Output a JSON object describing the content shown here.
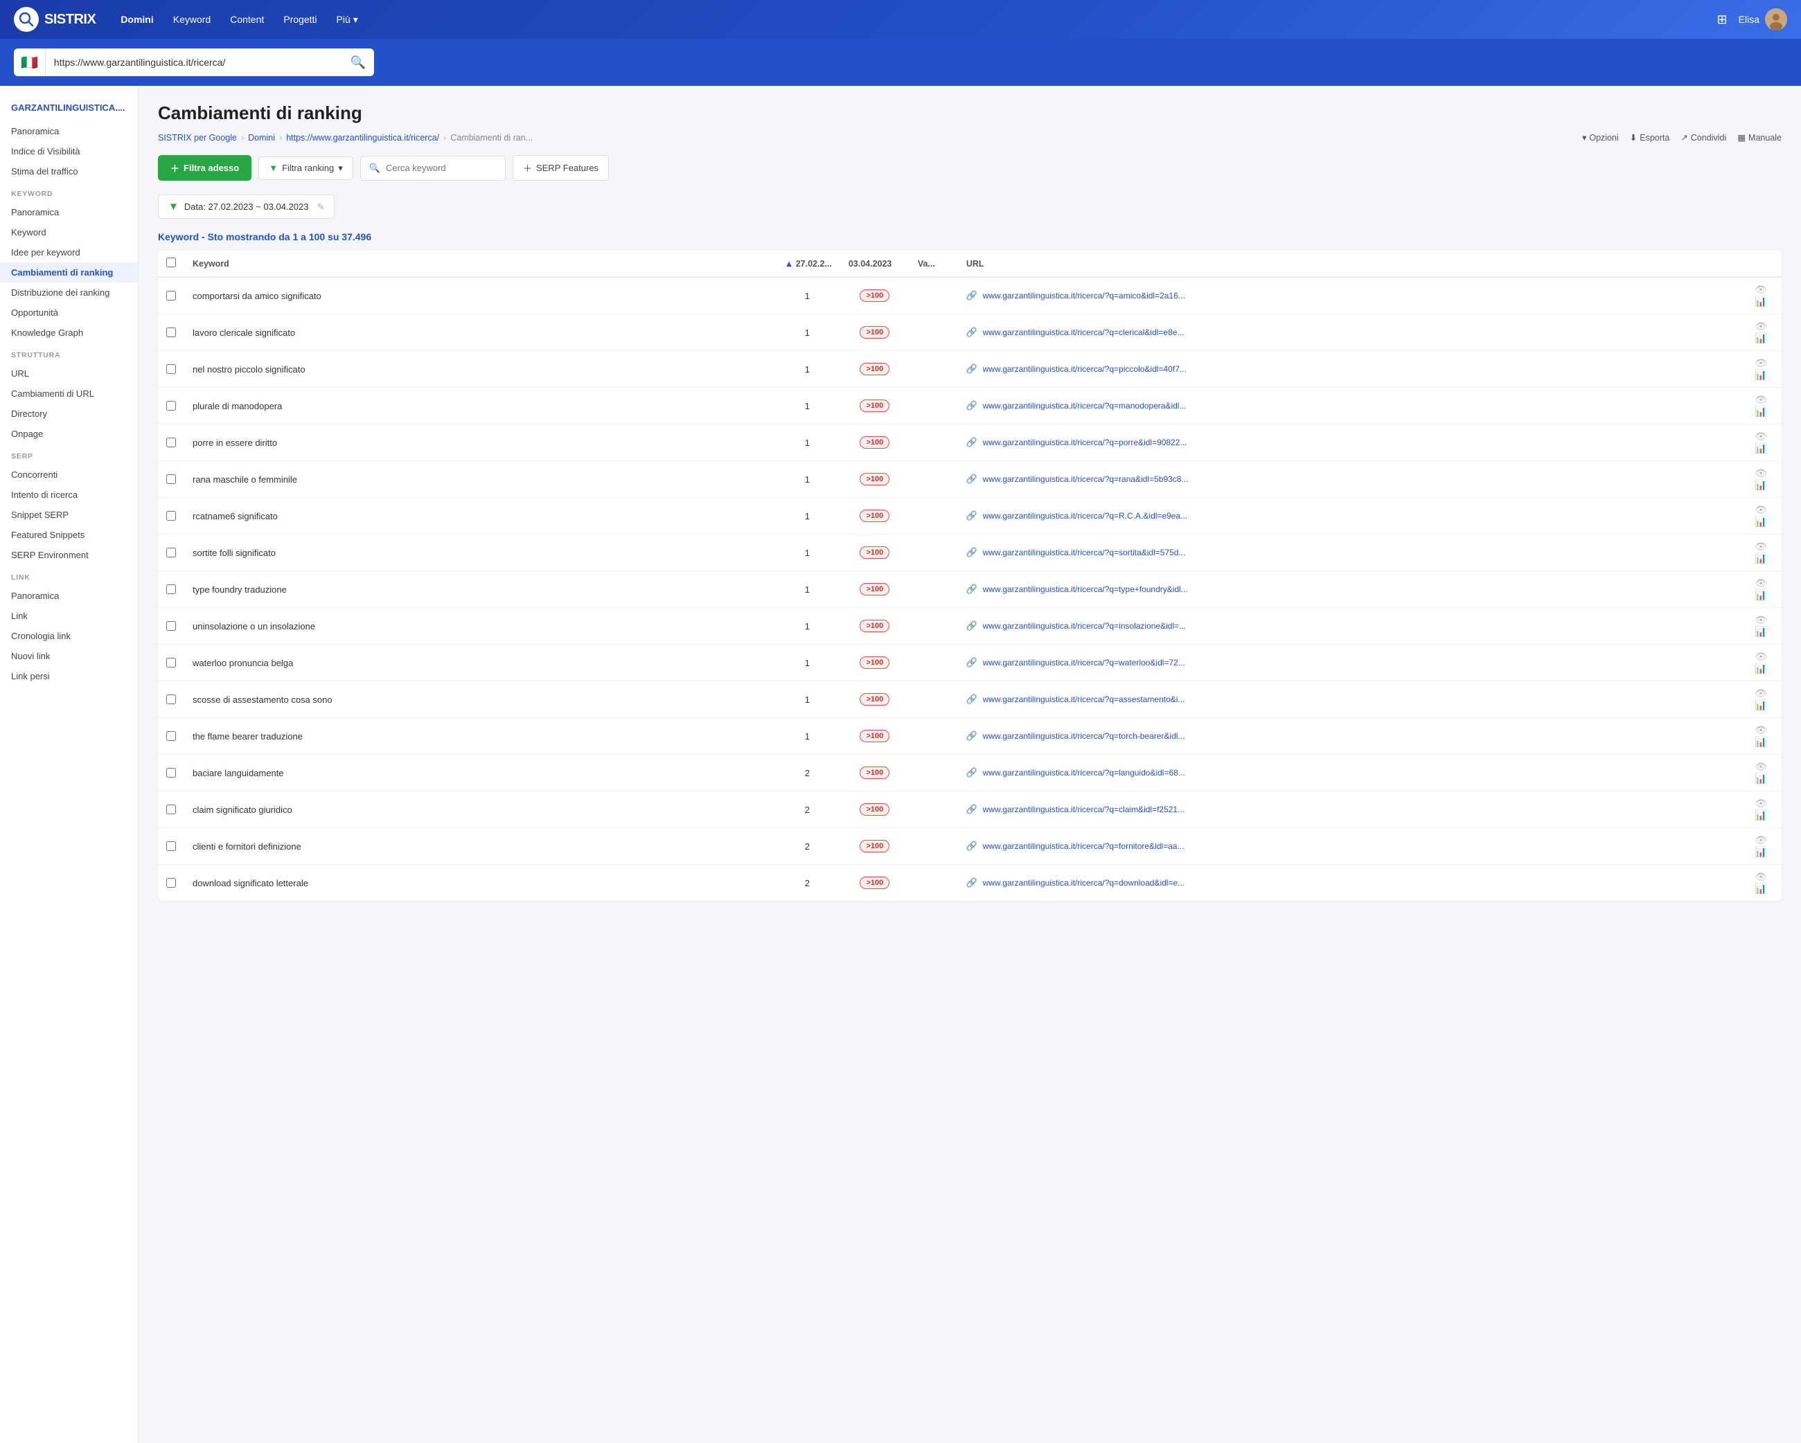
{
  "topnav": {
    "logo_text": "SISTRIX",
    "nav_items": [
      {
        "label": "Domini",
        "active": true
      },
      {
        "label": "Keyword",
        "active": false
      },
      {
        "label": "Content",
        "active": false
      },
      {
        "label": "Progetti",
        "active": false
      },
      {
        "label": "Più",
        "active": false,
        "dropdown": true
      }
    ],
    "user_name": "Elisa"
  },
  "searchbar": {
    "flag": "🇮🇹",
    "url_value": "https://www.garzantilinguistica.it/ricerca/",
    "placeholder": "https://www.garzantilinguistica.it/ricerca/"
  },
  "sidebar": {
    "domain": "GARZANTILINGUISTICA....",
    "sections": [
      {
        "items": [
          {
            "label": "Panoramica",
            "active": false
          },
          {
            "label": "Indice di Visibilità",
            "active": false
          },
          {
            "label": "Stima del traffico",
            "active": false
          }
        ]
      },
      {
        "title": "KEYWORD",
        "items": [
          {
            "label": "Panoramica",
            "active": false
          },
          {
            "label": "Keyword",
            "active": false
          },
          {
            "label": "Idee per keyword",
            "active": false
          },
          {
            "label": "Cambiamenti di ranking",
            "active": true
          },
          {
            "label": "Distribuzione dei ranking",
            "active": false
          },
          {
            "label": "Opportunità",
            "active": false
          },
          {
            "label": "Knowledge Graph",
            "active": false
          }
        ]
      },
      {
        "title": "STRUTTURA",
        "items": [
          {
            "label": "URL",
            "active": false
          },
          {
            "label": "Cambiamenti di URL",
            "active": false
          },
          {
            "label": "Directory",
            "active": false
          },
          {
            "label": "Onpage",
            "active": false
          }
        ]
      },
      {
        "title": "SERP",
        "items": [
          {
            "label": "Concorrenti",
            "active": false
          },
          {
            "label": "Intento di ricerca",
            "active": false
          },
          {
            "label": "Snippet SERP",
            "active": false
          },
          {
            "label": "Featured Snippets",
            "active": false
          },
          {
            "label": "SERP Environment",
            "active": false
          }
        ]
      },
      {
        "title": "LINK",
        "items": [
          {
            "label": "Panoramica",
            "active": false
          },
          {
            "label": "Link",
            "active": false
          },
          {
            "label": "Cronologia link",
            "active": false
          },
          {
            "label": "Nuovi link",
            "active": false
          },
          {
            "label": "Link persi",
            "active": false
          }
        ]
      }
    ]
  },
  "main": {
    "page_title": "Cambiamenti di ranking",
    "breadcrumb": {
      "items": [
        {
          "label": "SISTRIX per Google",
          "link": true
        },
        {
          "label": "Domini",
          "link": true
        },
        {
          "label": "https://www.garzantilinguistica.it/ricerca/",
          "link": true
        },
        {
          "label": "Cambiamenti di ran...",
          "link": false
        }
      ],
      "actions": [
        {
          "label": "Opzioni",
          "icon": "▼"
        },
        {
          "label": "Esporta",
          "icon": "⬇"
        },
        {
          "label": "Condividi",
          "icon": "↗"
        },
        {
          "label": "Manuale",
          "icon": "▦"
        }
      ]
    },
    "toolbar": {
      "filter_now": "Filtra adesso",
      "filter_ranking": "Filtra ranking",
      "search_placeholder": "Cerca keyword",
      "serp_features": "SERP Features"
    },
    "date_filter": {
      "text": "Data: 27.02.2023 ~ 03.04.2023"
    },
    "section_heading": "Keyword - Sto mostrando da 1 a 100 su 37.496",
    "table": {
      "headers": [
        {
          "label": "",
          "type": "check"
        },
        {
          "label": "Keyword",
          "sortable": true
        },
        {
          "label": "27.02.2...",
          "sortable": true,
          "active": true
        },
        {
          "label": "03.04.2023",
          "sortable": true
        },
        {
          "label": "Va...",
          "sortable": true
        },
        {
          "label": "URL",
          "sortable": false
        }
      ],
      "rows": [
        {
          "keyword": "comportarsi da amico significato",
          "date1": "1",
          "date2": ">100",
          "url": "www.garzantilinguistica.it/ricerca/?q=amico&idl=2a16..."
        },
        {
          "keyword": "lavoro clericale significato",
          "date1": "1",
          "date2": ">100",
          "url": "www.garzantilinguistica.it/ricerca/?q=clerical&idl=e8e..."
        },
        {
          "keyword": "nel nostro piccolo significato",
          "date1": "1",
          "date2": ">100",
          "url": "www.garzantilinguistica.it/ricerca/?q=piccolo&idl=40f7..."
        },
        {
          "keyword": "plurale di manodopera",
          "date1": "1",
          "date2": ">100",
          "url": "www.garzantilinguistica.it/ricerca/?q=manodopera&idl..."
        },
        {
          "keyword": "porre in essere diritto",
          "date1": "1",
          "date2": ">100",
          "url": "www.garzantilinguistica.it/ricerca/?q=porre&idl=90822..."
        },
        {
          "keyword": "rana maschile o femminile",
          "date1": "1",
          "date2": ">100",
          "url": "www.garzantilinguistica.it/ricerca/?q=rana&idl=5b93c8..."
        },
        {
          "keyword": "rcatname6 significato",
          "date1": "1",
          "date2": ">100",
          "url": "www.garzantilinguistica.it/ricerca/?q=R.C.A.&idl=e9ea..."
        },
        {
          "keyword": "sortite folli significato",
          "date1": "1",
          "date2": ">100",
          "url": "www.garzantilinguistica.it/ricerca/?q=sortita&idl=575d..."
        },
        {
          "keyword": "type foundry traduzione",
          "date1": "1",
          "date2": ">100",
          "url": "www.garzantilinguistica.it/ricerca/?q=type+foundry&idl..."
        },
        {
          "keyword": "uninsolazione o un insolazione",
          "date1": "1",
          "date2": ">100",
          "url": "www.garzantilinguistica.it/ricerca/?q=insolazione&idl=..."
        },
        {
          "keyword": "waterloo pronuncia belga",
          "date1": "1",
          "date2": ">100",
          "url": "www.garzantilinguistica.it/ricerca/?q=waterloo&idl=72..."
        },
        {
          "keyword": "scosse di assestamento cosa sono",
          "date1": "1",
          "date2": ">100",
          "url": "www.garzantilinguistica.it/ricerca/?q=assestamento&i..."
        },
        {
          "keyword": "the flame bearer traduzione",
          "date1": "1",
          "date2": ">100",
          "url": "www.garzantilinguistica.it/ricerca/?q=torch-bearer&idl..."
        },
        {
          "keyword": "baciare languidamente",
          "date1": "2",
          "date2": ">100",
          "url": "www.garzantilinguistica.it/ricerca/?q=languido&idl=68..."
        },
        {
          "keyword": "claim significato giuridico",
          "date1": "2",
          "date2": ">100",
          "url": "www.garzantilinguistica.it/ricerca/?q=claim&idl=f2521..."
        },
        {
          "keyword": "clienti e fornitori definizione",
          "date1": "2",
          "date2": ">100",
          "url": "www.garzantilinguistica.it/ricerca/?q=fornitore&idl=aa..."
        },
        {
          "keyword": "download significato letterale",
          "date1": "2",
          "date2": ">100",
          "url": "www.garzantilinguistica.it/ricerca/?q=download&idl=e..."
        }
      ]
    }
  },
  "icons": {
    "search": "🔍",
    "filter": "▼",
    "plus": "+",
    "eye": "👁",
    "chart": "📊",
    "link": "🔗",
    "edit": "✎",
    "download": "⬇",
    "share": "↗",
    "manual": "▦",
    "grid": "⊞",
    "chevron_down": "▾"
  },
  "colors": {
    "primary": "#2451c7",
    "green": "#28a745",
    "red_badge": "#c0392b",
    "nav_bg": "#1a3caa",
    "active_link": "#2451c7"
  }
}
